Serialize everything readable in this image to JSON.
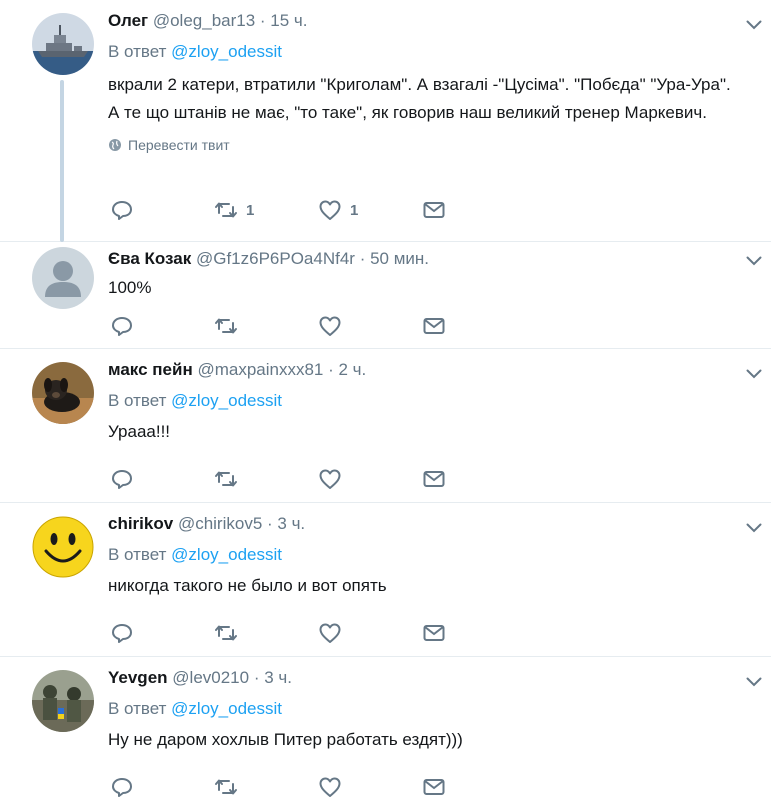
{
  "colors": {
    "link": "#1da1f2",
    "muted": "#657786",
    "text": "#14171a",
    "divider": "#e6ecf0",
    "thread": "#c4d5e3"
  },
  "tweets": [
    {
      "name": "Олег",
      "handle": "@oleg_bar13",
      "sep": " · ",
      "time": "15 ч.",
      "reply_prefix": "В ответ ",
      "reply_to": "@zloy_odessit",
      "text": "вкрали 2 катери, втратили \"Криголам\". А взагалі -\"Цусіма\". \"Побєда\" \"Ура-Ура\". А те що штанів не має, \"то таке\", як говорив наш великий тренер Маркевич.",
      "translate": "Перевести твит",
      "reply_count": "",
      "retweet_count": "1",
      "like_count": "1",
      "avatar_icon": "warship-avatar"
    },
    {
      "name": "Єва Козак",
      "handle": "@Gf1z6P6POa4Nf4r",
      "sep": " · ",
      "time": "50 мин.",
      "text": "100%",
      "reply_count": "",
      "retweet_count": "",
      "like_count": "",
      "avatar_icon": "default-egg-avatar"
    },
    {
      "name": "макс пейн",
      "handle": "@maxpainxxx81",
      "sep": " · ",
      "time": "2 ч.",
      "reply_prefix": "В ответ ",
      "reply_to": "@zloy_odessit",
      "text": "Урааа!!!",
      "reply_count": "",
      "retweet_count": "",
      "like_count": "",
      "avatar_icon": "dog-avatar"
    },
    {
      "name": "chirikov",
      "handle": "@chirikov5",
      "sep": " · ",
      "time": "3 ч.",
      "reply_prefix": "В ответ ",
      "reply_to": "@zloy_odessit",
      "text": "никогда такого не было и вот опять",
      "reply_count": "",
      "retweet_count": "",
      "like_count": "",
      "avatar_icon": "smiley-avatar"
    },
    {
      "name": "Yevgen",
      "handle": "@lev0210",
      "sep": " · ",
      "time": "3 ч.",
      "reply_prefix": "В ответ ",
      "reply_to": "@zloy_odessit",
      "text": "Ну не даром хохлыв Питер работать ездят)))",
      "reply_count": "",
      "retweet_count": "",
      "like_count": "",
      "avatar_icon": "soldiers-photo-avatar"
    }
  ]
}
